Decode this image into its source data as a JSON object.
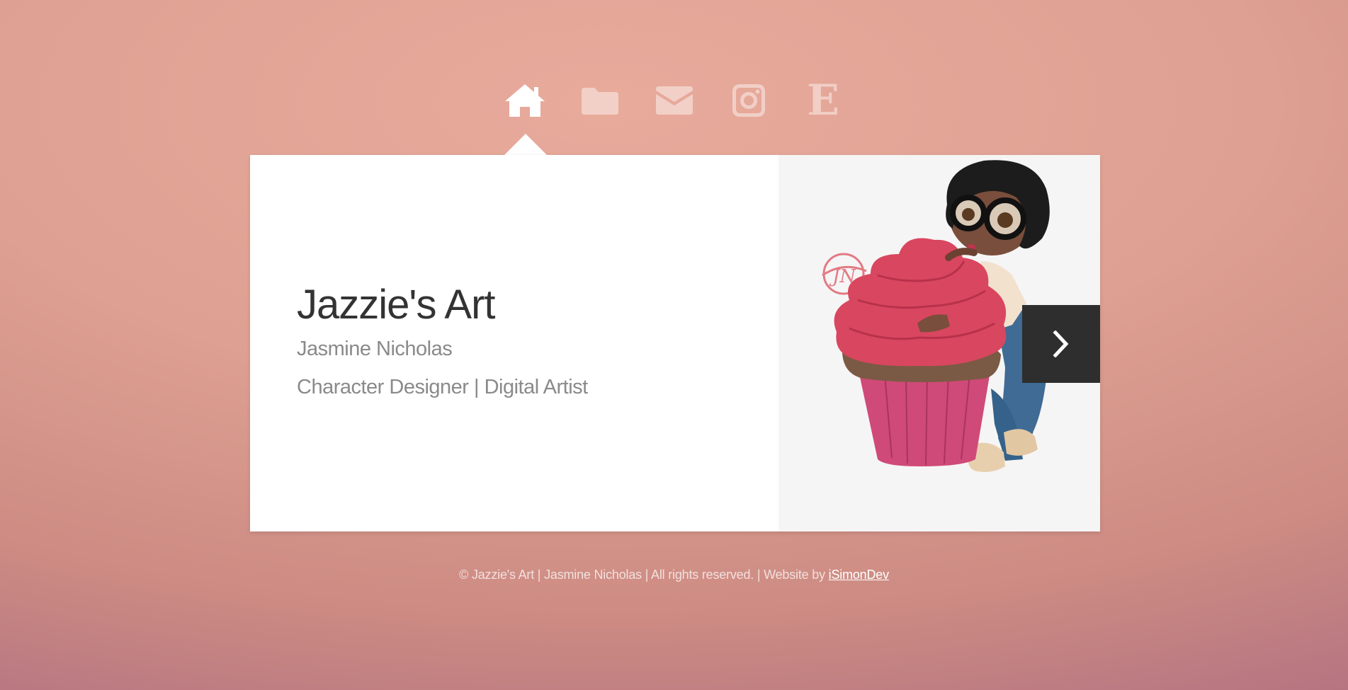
{
  "nav": {
    "items": [
      {
        "icon": "home-icon",
        "active": true
      },
      {
        "icon": "folder-icon",
        "active": false
      },
      {
        "icon": "envelope-icon",
        "active": false
      },
      {
        "icon": "instagram-icon",
        "active": false
      },
      {
        "icon": "etsy-icon",
        "active": false,
        "glyph": "E"
      }
    ]
  },
  "hero": {
    "title": "Jazzie's Art",
    "name": "Jasmine Nicholas",
    "tagline": "Character Designer | Digital Artist",
    "logo_text": "JN"
  },
  "slider": {
    "next_icon": "chevron-right-icon"
  },
  "footer": {
    "text": "© Jazzie's Art | Jasmine Nicholas | All rights reserved. | Website by ",
    "link_text": "iSimonDev"
  },
  "colors": {
    "background_top": "#e8aa9b",
    "background_bottom": "#8f5b78",
    "card": "#ffffff",
    "title": "#333333",
    "subtitle": "#8a8a8a",
    "next_button": "#2e2e2e",
    "frosting": "#d9465f",
    "cupcake_wrapper": "#cf4a78"
  }
}
